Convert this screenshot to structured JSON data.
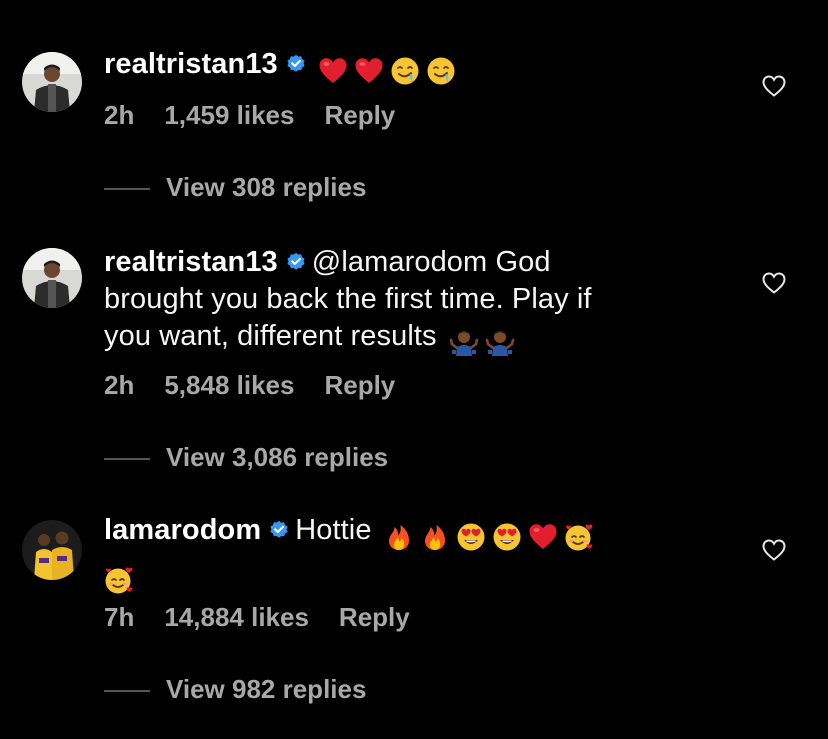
{
  "colors": {
    "background": "#000000",
    "text": "#ffffff",
    "meta": "#a8a8a8",
    "verified": "#3897f0"
  },
  "comments": [
    {
      "username": "realtristan13",
      "body": "",
      "emojis": [
        "red-heart",
        "red-heart",
        "drooling-face",
        "drooling-face"
      ],
      "time": "2h",
      "likes": "1,459 likes",
      "reply": "Reply",
      "view_replies": "View 308 replies"
    },
    {
      "username": "realtristan13",
      "body_line1": "@lamarodom God",
      "body_line2": "brought you back the first time. Play if",
      "body_line3": "you want, different results",
      "emojis": [
        "person-shrugging",
        "person-shrugging"
      ],
      "time": "2h",
      "likes": "5,848 likes",
      "reply": "Reply",
      "view_replies": "View 3,086 replies"
    },
    {
      "username": "lamarodom",
      "body": "Hottie",
      "emojis": [
        "fire",
        "fire",
        "heart-eyes",
        "heart-eyes",
        "red-heart",
        "smiling-face-with-hearts",
        "smiling-face-with-hearts"
      ],
      "time": "7h",
      "likes": "14,884 likes",
      "reply": "Reply",
      "view_replies": "View 982 replies"
    }
  ]
}
